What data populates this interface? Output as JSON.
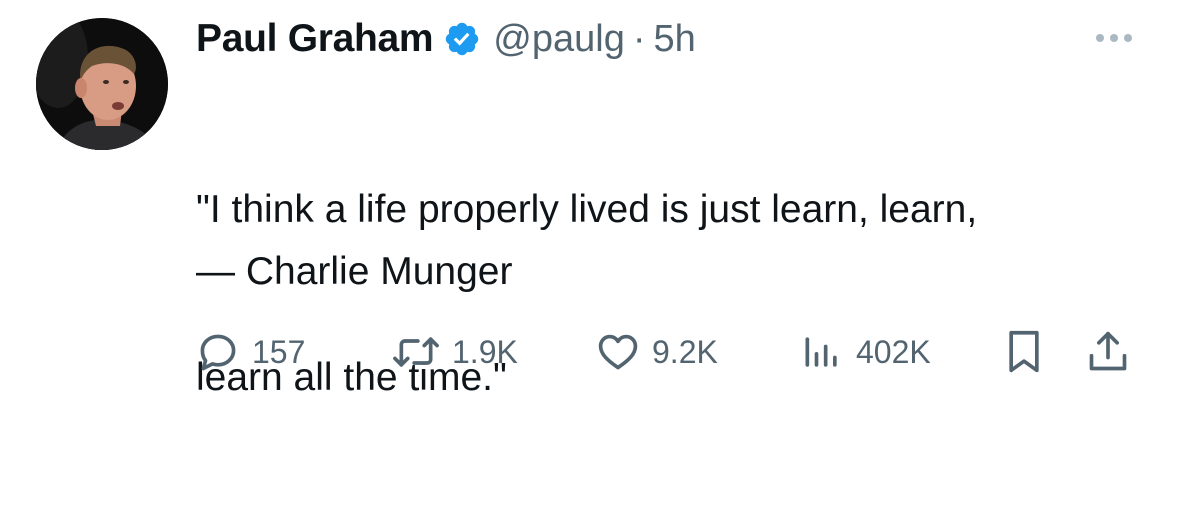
{
  "author": {
    "display_name": "Paul Graham",
    "handle": "@paulg",
    "separator": "·",
    "time": "5h",
    "verified": true,
    "verified_color": "#1d9bf0"
  },
  "tweet": {
    "quote_lines": [
      "\"I think a life properly lived is just learn, learn,",
      "learn all the time.\""
    ],
    "attribution": "— Charlie Munger"
  },
  "actions": {
    "replies": "157",
    "retweets": "1.9K",
    "likes": "9.2K",
    "views": "402K"
  },
  "icons": {
    "more": "more-icon",
    "reply": "reply-icon",
    "retweet": "retweet-icon",
    "like": "heart-icon",
    "views": "views-icon",
    "bookmark": "bookmark-icon",
    "share": "share-icon"
  },
  "colors": {
    "text": "#0f1419",
    "muted": "#536471",
    "accent": "#1d9bf0"
  }
}
